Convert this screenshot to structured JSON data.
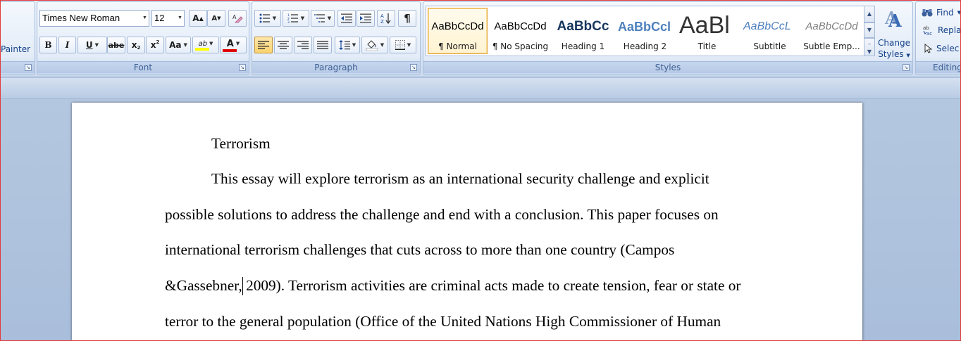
{
  "ribbon": {
    "clipboard": {
      "format_painter_label": "Painter"
    },
    "font": {
      "group_label": "Font",
      "font_name": "Times New Roman",
      "font_size": "12",
      "grow_font_label": "A",
      "shrink_font_label": "A",
      "bold_label": "B",
      "italic_label": "I",
      "underline_label": "U",
      "strikethrough_label": "abe",
      "subscript_label": "x",
      "superscript_label": "x",
      "change_case_label": "Aa",
      "highlight_label": "ab",
      "font_color_label": "A",
      "highlight_color": "#ffff00",
      "font_color": "#e00000"
    },
    "paragraph": {
      "group_label": "Paragraph"
    },
    "styles": {
      "group_label": "Styles",
      "change_styles_label_1": "Change",
      "change_styles_label_2": "Styles",
      "items": [
        {
          "preview": "AaBbCcDd",
          "name": "¶ Normal"
        },
        {
          "preview": "AaBbCcDd",
          "name": "¶ No Spacing"
        },
        {
          "preview": "AaBbCc",
          "name": "Heading 1"
        },
        {
          "preview": "AaBbCcl",
          "name": "Heading 2"
        },
        {
          "preview": "AaBl",
          "name": "Title"
        },
        {
          "preview": "AaBbCcL",
          "name": "Subtitle"
        },
        {
          "preview": "AaBbCcDd",
          "name": "Subtle Emp..."
        }
      ]
    },
    "editing": {
      "group_label": "Editing",
      "find_label": "Find",
      "replace_label": "Repla",
      "select_label": "Selec"
    }
  },
  "document": {
    "title": "Terrorism",
    "lines": [
      "This essay will explore terrorism as an international security challenge and explicit",
      "possible solutions to address the challenge and end with a conclusion. This paper focuses on",
      "international terrorism challenges that cuts across to more than one country (Campos",
      "&Gassebner, 2009). Terrorism activities are criminal acts made to create tension, fear or state or",
      "terror to the general population (Office of the United Nations High Commissioner of Human"
    ]
  }
}
